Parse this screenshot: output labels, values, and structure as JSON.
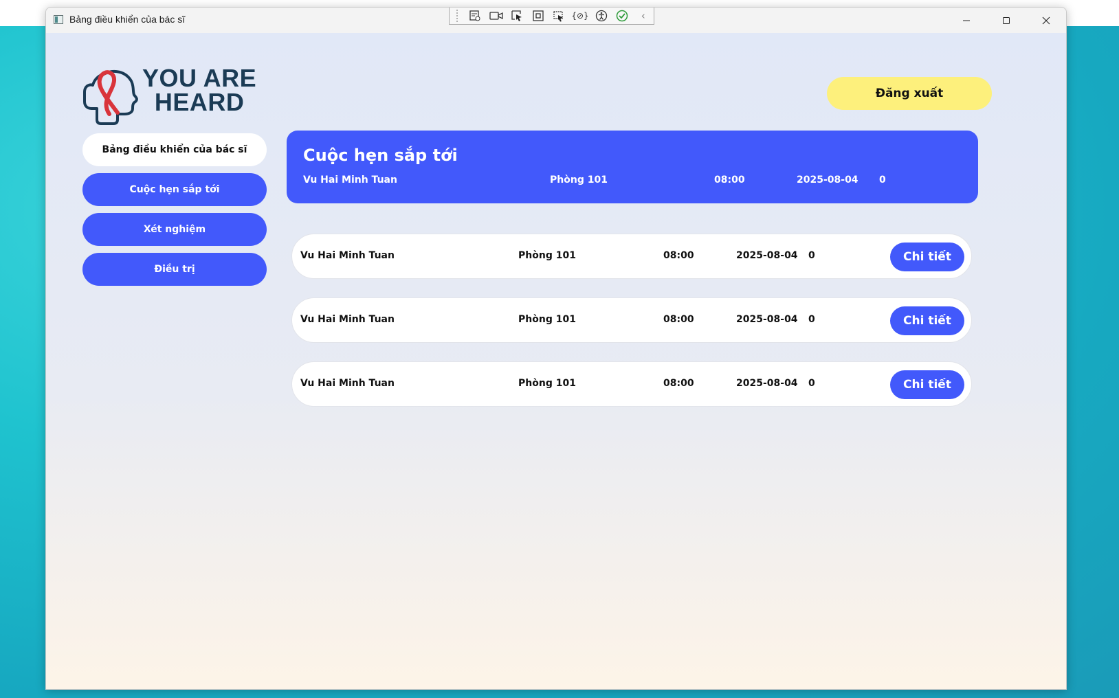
{
  "window": {
    "title": "Bảng điều khiển của bác sĩ"
  },
  "logo": {
    "line1": "YOU ARE",
    "line2": "HEARD"
  },
  "header": {
    "logout_label": "Đăng xuất"
  },
  "sidebar": {
    "items": [
      {
        "label": "Bảng điều khiển của bác sĩ"
      },
      {
        "label": "Cuộc hẹn sắp tới"
      },
      {
        "label": "Xét nghiệm"
      },
      {
        "label": "Điều trị"
      }
    ]
  },
  "banner": {
    "title": "Cuộc hẹn sắp tới",
    "patient": "Vu Hai Minh Tuan",
    "room": "Phòng 101",
    "time": "08:00",
    "date": "2025-08-04",
    "count": "0"
  },
  "appointments": [
    {
      "patient": "Vu Hai Minh Tuan",
      "room": "Phòng 101",
      "time": "08:00",
      "date": "2025-08-04",
      "count": "0",
      "action": "Chi tiết"
    },
    {
      "patient": "Vu Hai Minh Tuan",
      "room": "Phòng 101",
      "time": "08:00",
      "date": "2025-08-04",
      "count": "0",
      "action": "Chi tiết"
    },
    {
      "patient": "Vu Hai Minh Tuan",
      "room": "Phòng 101",
      "time": "08:00",
      "date": "2025-08-04",
      "count": "0",
      "action": "Chi tiết"
    }
  ],
  "colors": {
    "accent": "#4259fb",
    "logout": "#fdf07c",
    "logo_text": "#1b3b55",
    "ribbon": "#d9343b"
  },
  "icons": {
    "toolbar": [
      "live-visual-tree-icon",
      "video-icon",
      "select-element-icon",
      "display-layout-adorners-icon",
      "track-focused-element-icon",
      "binding-failures-icon",
      "accessibility-icon",
      "check-icon",
      "collapse-icon"
    ],
    "window": [
      "minimize-icon",
      "maximize-icon",
      "close-icon"
    ]
  }
}
